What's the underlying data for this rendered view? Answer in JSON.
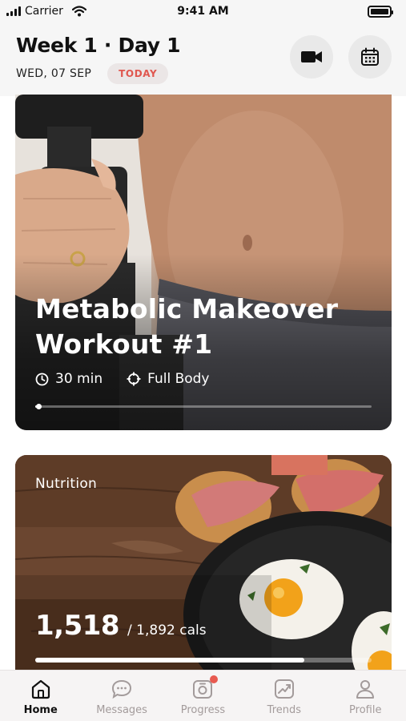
{
  "status_bar": {
    "carrier": "Carrier",
    "time": "9:41 AM"
  },
  "header": {
    "title": "Week 1 · Day 1",
    "date": "WED, 07 SEP",
    "badge": "TODAY",
    "video_icon": "video-camera-icon",
    "calendar_icon": "calendar-icon"
  },
  "workout": {
    "title": "Metabolic Makeover Workout #1",
    "duration": "30 min",
    "focus": "Full Body",
    "progress": 0.01
  },
  "nutrition": {
    "label": "Nutrition",
    "calories": "1,518",
    "target": "/ 1,892 cals",
    "progress": 0.8
  },
  "tabs": [
    {
      "label": "Home",
      "icon": "home-icon",
      "active": true
    },
    {
      "label": "Messages",
      "icon": "chat-icon",
      "active": false
    },
    {
      "label": "Progress",
      "icon": "camera-progress-icon",
      "active": false,
      "notification": true
    },
    {
      "label": "Trends",
      "icon": "trend-chart-icon",
      "active": false
    },
    {
      "label": "Profile",
      "icon": "person-icon",
      "active": false
    }
  ],
  "colors": {
    "accent": "#e0574f",
    "notification": "#e85a50",
    "tab_inactive": "#a39b9b"
  }
}
